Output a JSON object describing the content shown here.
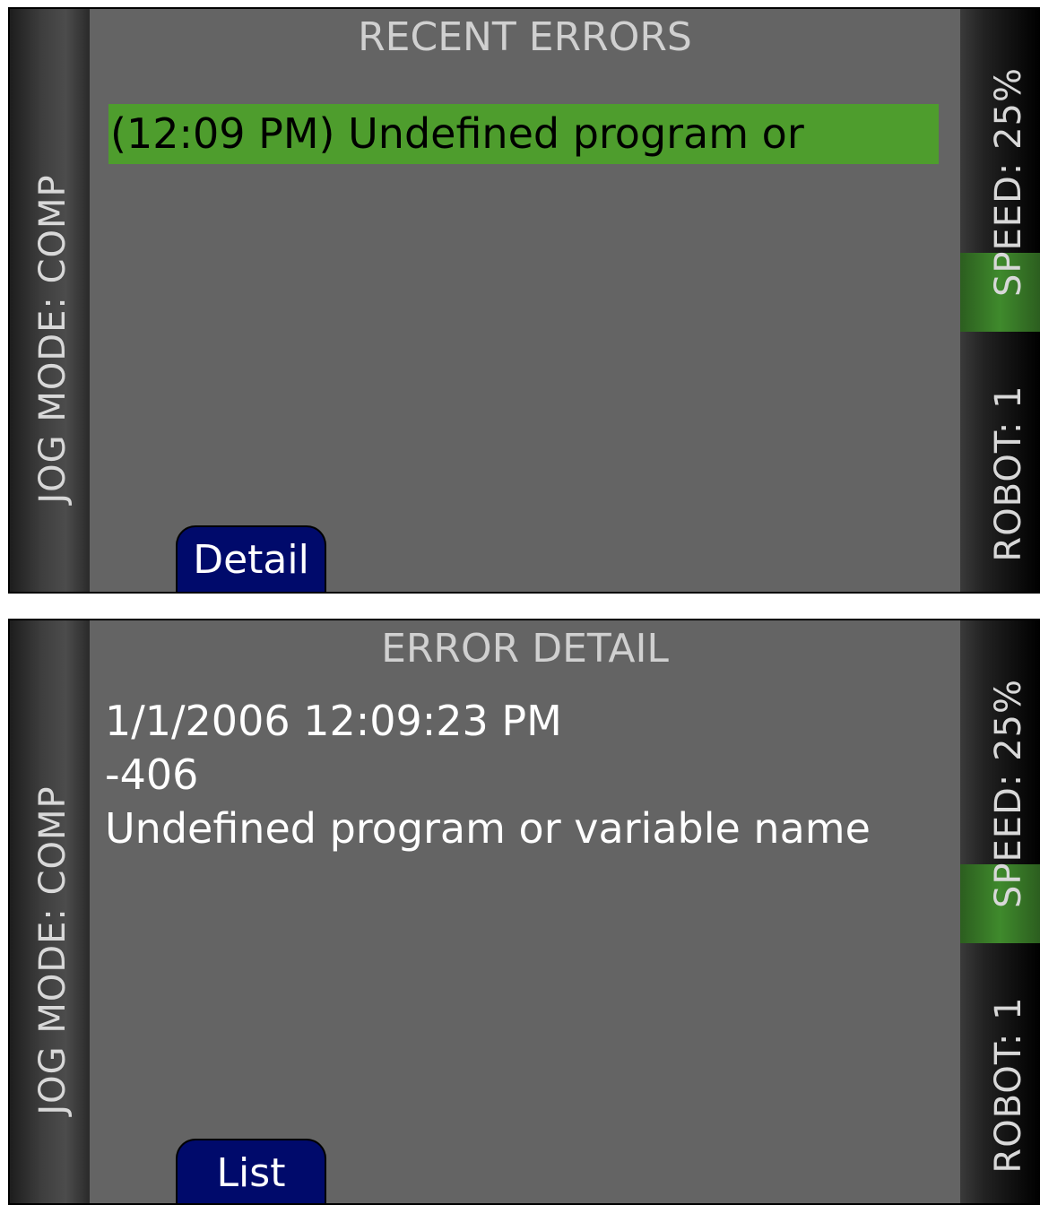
{
  "recent_errors_screen": {
    "title": "RECENT ERRORS",
    "jog_mode": "JOG MODE: COMP",
    "speed": "SPEED: 25%",
    "robot": "ROBOT: 1",
    "error_items": [
      "(12:09 PM) Undefined program or"
    ],
    "button_label": "Detail",
    "colors": {
      "background": "#646464",
      "highlight": "#4e9d2d",
      "button": "#000a6b"
    }
  },
  "error_detail_screen": {
    "title": "ERROR DETAIL",
    "jog_mode": "JOG MODE: COMP",
    "speed": "SPEED: 25%",
    "robot": "ROBOT: 1",
    "timestamp": "1/1/2006 12:09:23 PM",
    "error_code": "-406",
    "message": "Undefined program or variable name",
    "button_label": "List"
  }
}
